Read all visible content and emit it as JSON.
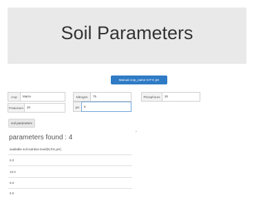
{
  "banner": {
    "title": "Soil Parameters"
  },
  "manual_button": "Manual crop_name N P K pH",
  "fields": {
    "crop": {
      "label": "crop",
      "value": "Maize"
    },
    "nitrogen": {
      "label": "Nitrogen",
      "value": "75"
    },
    "phosphorus": {
      "label": "Phosphorus",
      "value": "30"
    },
    "potassium": {
      "label": "Potassium",
      "value": "20"
    },
    "ph": {
      "label": "pH",
      "value": "6"
    }
  },
  "soil_button": "soil parameters",
  "results": {
    "found_label": "parameters found : 4",
    "header": "available soil nutrition level(N,P,K,pH)",
    "values": [
      "5.0",
      "10.0",
      "8.0",
      "6.5"
    ]
  }
}
